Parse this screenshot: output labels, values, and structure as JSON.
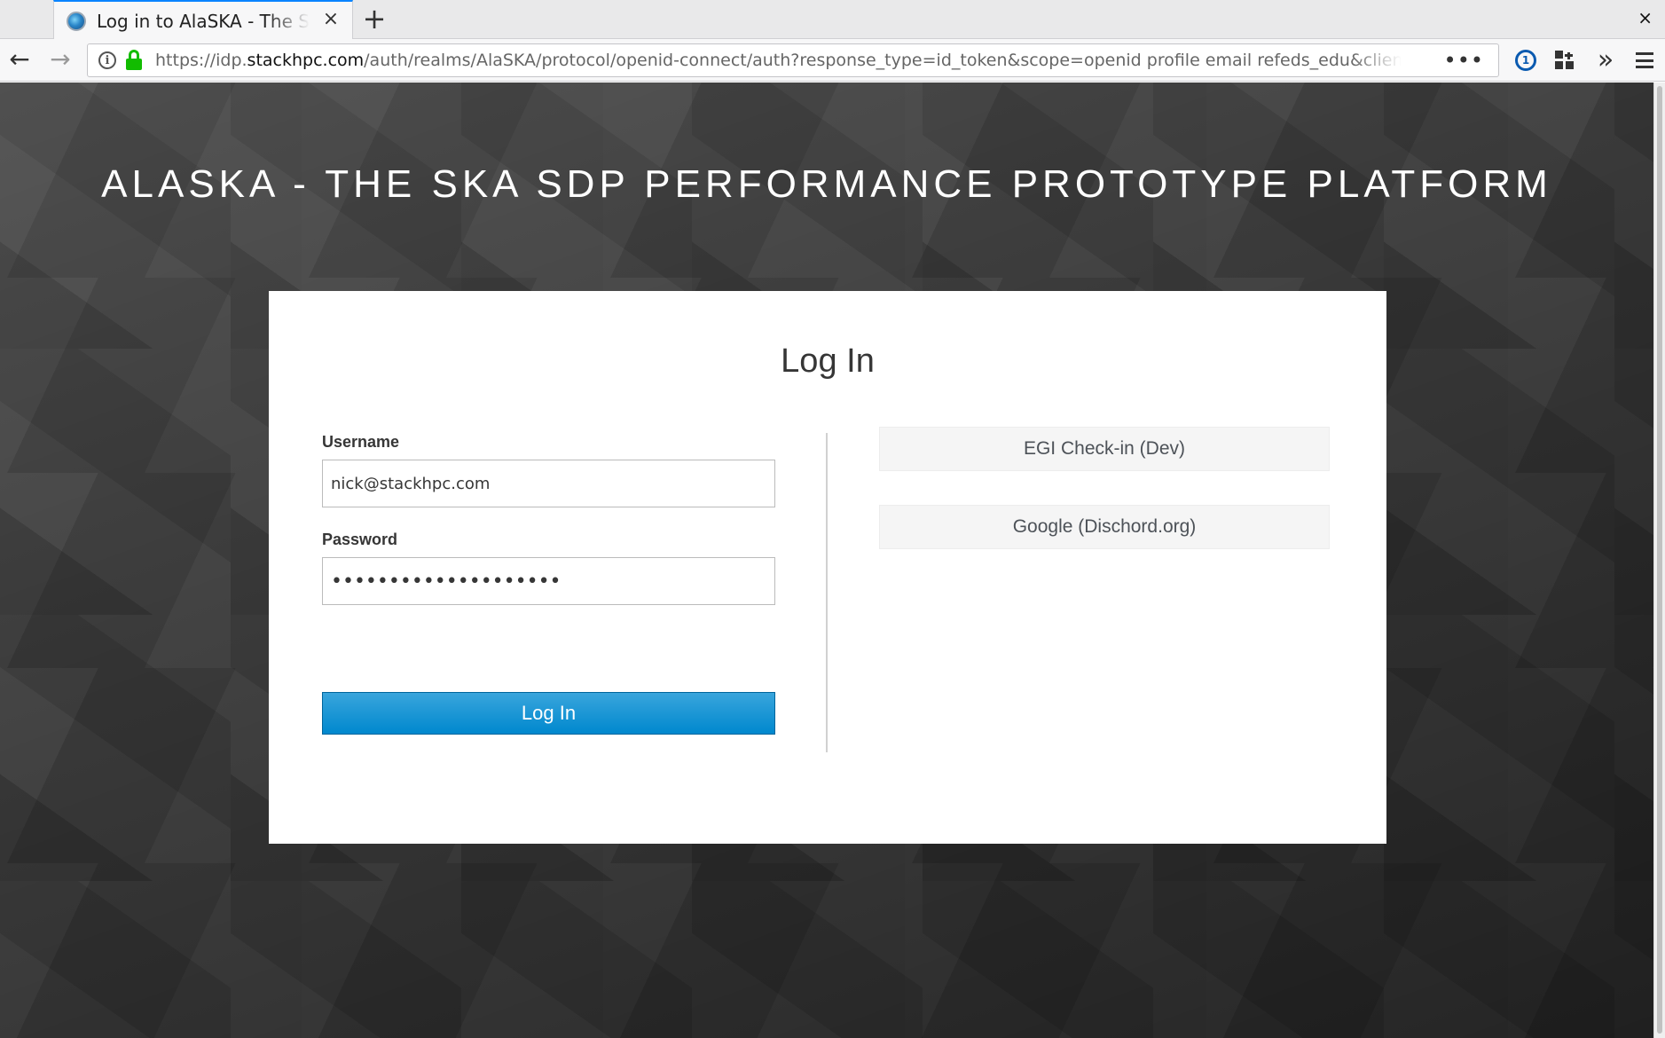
{
  "browser": {
    "tab_title": "Log in to AlaSKA - The SKA SDP Performance Prototype Platform",
    "new_tab_glyph": "+",
    "close_glyph": "×",
    "window_close_glyph": "×",
    "url_scheme": "https://idp.",
    "url_host": "stackhpc.com",
    "url_path": "/auth/realms/AlaSKA/protocol/openid-connect/auth?response_type=id_token&scope=openid profile email refeds_edu&client_id=alaska-",
    "url_more_glyph": "•••",
    "back_glyph": "←",
    "forward_glyph": "→",
    "overflow_glyph": "»",
    "icons": [
      "back-icon",
      "forward-icon",
      "info-icon",
      "lock-icon",
      "page-actions-icon",
      "password-manager-icon",
      "containers-icon",
      "overflow-icon",
      "menu-icon"
    ]
  },
  "page": {
    "site_title": "ALASKA - THE SKA SDP PERFORMANCE PROTOTYPE PLATFORM",
    "card_title": "Log In",
    "username_label": "Username",
    "username_value": "nick@stackhpc.com",
    "password_label": "Password",
    "password_mask": "••••••••••••••••••••",
    "login_button": "Log In",
    "providers": [
      {
        "label": "EGI Check-in (Dev)"
      },
      {
        "label": "Google (Dischord.org)"
      }
    ]
  },
  "colors": {
    "accent_blue": "#0088ce",
    "secure_green": "#12bc00",
    "tab_highlight": "#0a84ff"
  }
}
